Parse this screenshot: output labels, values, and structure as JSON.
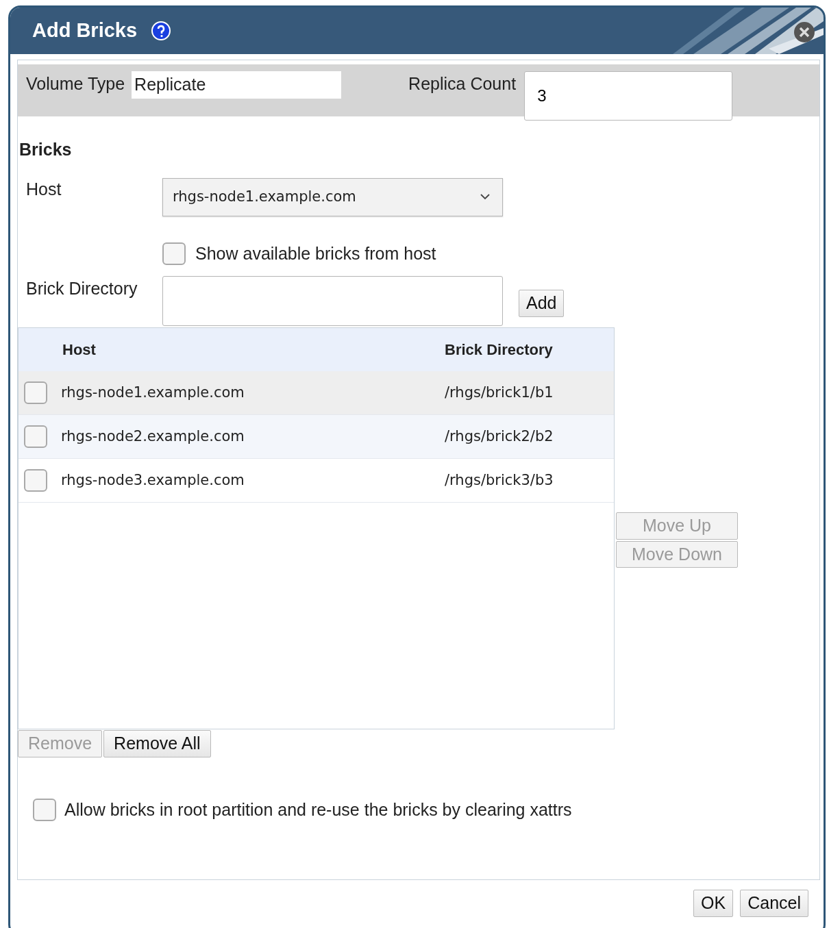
{
  "dialog": {
    "title": "Add Bricks"
  },
  "volume": {
    "type_label": "Volume Type",
    "type_value": "Replicate",
    "replica_label": "Replica Count",
    "replica_value": "3"
  },
  "bricks": {
    "heading": "Bricks",
    "host_label": "Host",
    "host_value": "rhgs-node1.example.com",
    "show_available": {
      "label": "Show available bricks from host",
      "checked": false
    },
    "directory_label": "Brick Directory",
    "add_button": {
      "label": "Add",
      "disabled": false
    }
  },
  "table": {
    "columns": [
      "Host",
      "Brick Directory"
    ],
    "rows": [
      {
        "host": "rhgs-node1.example.com",
        "directory": "/rhgs/brick1/b1",
        "checked": false
      },
      {
        "host": "rhgs-node2.example.com",
        "directory": "/rhgs/brick2/b2",
        "checked": false
      },
      {
        "host": "rhgs-node3.example.com",
        "directory": "/rhgs/brick3/b3",
        "checked": false
      }
    ]
  },
  "side_buttons": [
    {
      "label": "Move Up",
      "disabled": true
    },
    {
      "label": "Move Down",
      "disabled": true
    }
  ],
  "list_buttons": [
    {
      "label": "Remove",
      "disabled": true
    },
    {
      "label": "Remove All",
      "disabled": false
    }
  ],
  "allow_root": {
    "label": "Allow bricks in root partition and re-use the bricks by clearing xattrs",
    "checked": false
  },
  "footer_buttons": [
    {
      "label": "OK",
      "disabled": false
    },
    {
      "label": "Cancel",
      "disabled": false
    }
  ]
}
